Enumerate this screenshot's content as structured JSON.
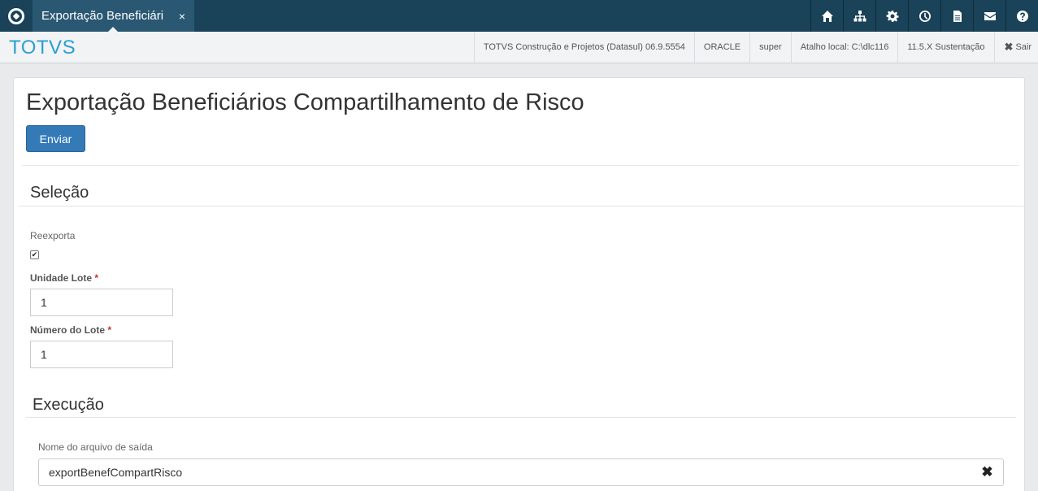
{
  "topbar": {
    "tab_title": "Exportação Beneficiári",
    "tab_close": "×",
    "icons": [
      "home-icon",
      "sitemap-icon",
      "gear-icon",
      "clock-icon",
      "document-icon",
      "mail-icon",
      "help-icon"
    ]
  },
  "header": {
    "brand": "TOTVS",
    "product": "TOTVS Construção e Projetos (Datasul) 06.9.5554",
    "database": "ORACLE",
    "user": "super",
    "shortcut": "Atalho local: C:\\dlc116",
    "version": "11.5.X Sustentação",
    "logout_icon": "✖",
    "logout": "Sair"
  },
  "page": {
    "title": "Exportação Beneficiários Compartilhamento de Risco",
    "submit_label": "Enviar"
  },
  "selection": {
    "title": "Seleção",
    "reexport_label": "Reexporta",
    "reexport_checked": true,
    "unit_label": "Unidade Lote",
    "unit_value": "1",
    "batch_label": "Número do Lote",
    "batch_value": "1",
    "required_mark": "*"
  },
  "execution": {
    "title": "Execução",
    "output_label": "Nome do arquivo de saída",
    "output_value": "exportBenefCompartRisco",
    "clear_icon": "✖"
  },
  "colors": {
    "topbar": "#1a4258",
    "tab": "#2a5873",
    "brand": "#2a9fd6",
    "primary_button": "#337ab7",
    "required": "#c9302c"
  }
}
